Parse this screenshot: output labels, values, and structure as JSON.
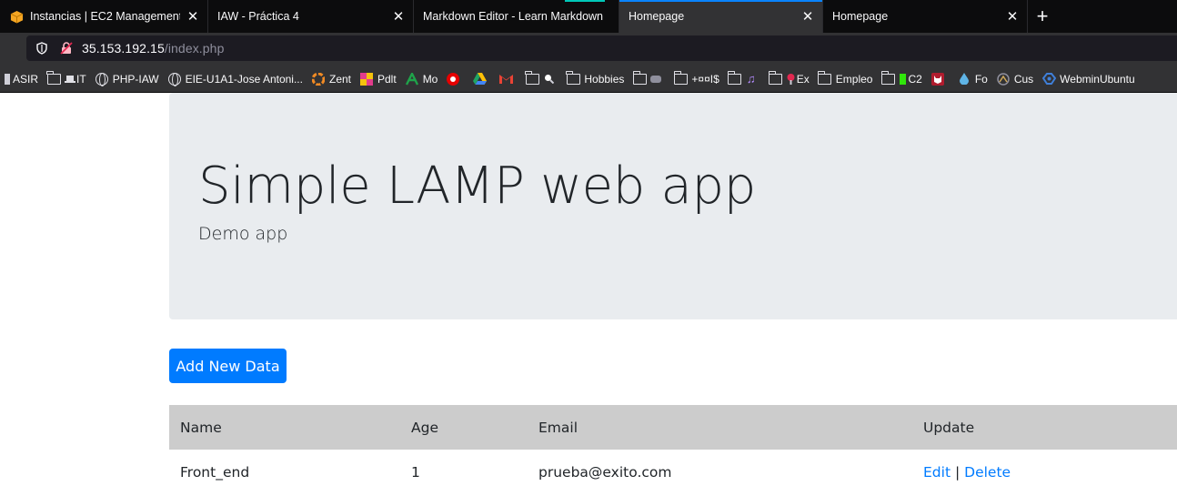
{
  "browser": {
    "tabs": [
      {
        "title": "Instancias | EC2 Management C",
        "favicon": "aws-box-icon",
        "active": false
      },
      {
        "title": "IAW - Práctica 4",
        "favicon": "",
        "active": false
      },
      {
        "title": "Markdown Editor - Learn Markdown",
        "favicon": "",
        "active": false
      },
      {
        "title": "Homepage",
        "favicon": "",
        "active": true
      },
      {
        "title": "Homepage",
        "favicon": "",
        "active": false
      }
    ],
    "url_host": "35.153.192.15",
    "url_path": "/index.php",
    "bookmarks": [
      {
        "label": "ASIR",
        "icon": "bookmark-icon"
      },
      {
        "label": "IT",
        "icon": "folder-laptop-icon"
      },
      {
        "label": "PHP-IAW",
        "icon": "globe-icon"
      },
      {
        "label": "EIE-U1A1-Jose Antoni...",
        "icon": "globe-icon"
      },
      {
        "label": "Zent",
        "icon": "zent-icon"
      },
      {
        "label": "Pdlt",
        "icon": "pdlt-icon"
      },
      {
        "label": "Mo",
        "icon": "andalucia-icon"
      },
      {
        "label": "",
        "icon": "vodafone-icon"
      },
      {
        "label": "",
        "icon": "drive-icon"
      },
      {
        "label": "",
        "icon": "gmail-icon"
      },
      {
        "label": "",
        "icon": "folder-search-icon"
      },
      {
        "label": "Hobbies",
        "icon": "folder-icon"
      },
      {
        "label": "",
        "icon": "folder-gamepad-icon"
      },
      {
        "label": "+¤¤I$",
        "icon": "folder-icon"
      },
      {
        "label": "",
        "icon": "folder-music-icon"
      },
      {
        "label": "Ex",
        "icon": "folder-ex-icon"
      },
      {
        "label": "Empleo",
        "icon": "folder-icon"
      },
      {
        "label": "C2",
        "icon": "folder-battery-icon"
      },
      {
        "label": "",
        "icon": "devil-icon"
      },
      {
        "label": "Fo",
        "icon": "drop-icon"
      },
      {
        "label": "Cus",
        "icon": "cus-icon"
      },
      {
        "label": "WebminUbuntu",
        "icon": "webmin-icon"
      }
    ]
  },
  "page": {
    "title": "Simple LAMP web app",
    "subtitle": "Demo app",
    "add_button": "Add New Data",
    "table": {
      "headers": [
        "Name",
        "Age",
        "Email",
        "Update"
      ],
      "rows": [
        {
          "name": "Front_end",
          "age": "1",
          "email": "prueba@exito.com",
          "edit": "Edit",
          "sep": "|",
          "delete": "Delete"
        }
      ]
    }
  },
  "colors": {
    "primary": "#007bff",
    "jumbotron": "#e9ecef",
    "table_header": "#cccccc"
  }
}
